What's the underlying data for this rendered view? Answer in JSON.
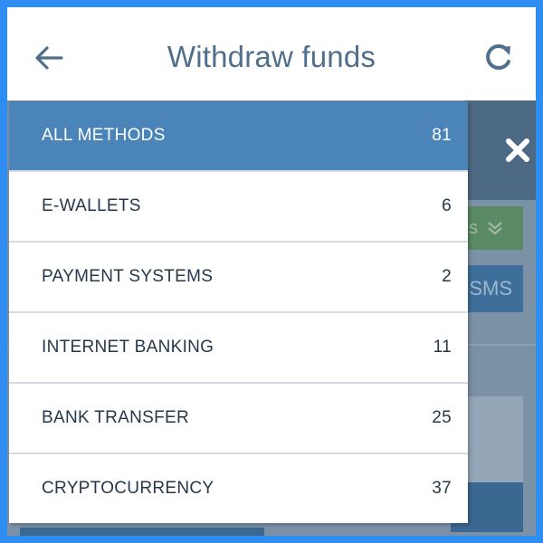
{
  "header": {
    "title": "Withdraw funds",
    "back_icon": "arrow-left-icon",
    "refresh_icon": "refresh-icon"
  },
  "background": {
    "green_button_text": "s",
    "blue_button_text": "SMS",
    "close_icon": "close-icon"
  },
  "methods": {
    "items": [
      {
        "label": "ALL METHODS",
        "count": "81",
        "active": true
      },
      {
        "label": "E-WALLETS",
        "count": "6"
      },
      {
        "label": "PAYMENT SYSTEMS",
        "count": "2"
      },
      {
        "label": "INTERNET BANKING",
        "count": "11"
      },
      {
        "label": "BANK TRANSFER",
        "count": "25"
      },
      {
        "label": "CRYPTOCURRENCY",
        "count": "37"
      }
    ]
  },
  "colors": {
    "accent": "#4a84b8",
    "title": "#4f6f8d",
    "frame_border": "#2f8cf0"
  }
}
